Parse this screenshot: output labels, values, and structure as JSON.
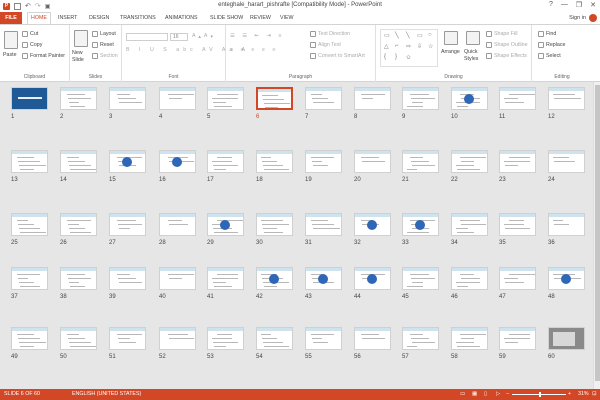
{
  "app": {
    "title": "enteghale_harart_pishrafte [Compatibility Mode] - PowerPoint",
    "sign_in": "Sign in",
    "window_controls": [
      "?",
      "—",
      "❐",
      "✕"
    ]
  },
  "tabs": [
    {
      "label": "FILE",
      "kind": "file"
    },
    {
      "label": "HOME",
      "kind": "active"
    },
    {
      "label": "INSERT"
    },
    {
      "label": "DESIGN"
    },
    {
      "label": "TRANSITIONS"
    },
    {
      "label": "ANIMATIONS"
    },
    {
      "label": "SLIDE SHOW"
    },
    {
      "label": "REVIEW"
    },
    {
      "label": "VIEW"
    }
  ],
  "ribbon": {
    "clipboard": {
      "paste": "Paste",
      "cut": "Cut",
      "copy": "Copy",
      "format_painter": "Format Painter",
      "label": "Clipboard"
    },
    "slides": {
      "new_slide": "New Slide",
      "layout": "Layout",
      "reset": "Reset",
      "section": "Section",
      "label": "Slides"
    },
    "font": {
      "label": "Font",
      "size": "16"
    },
    "paragraph": {
      "text_direction": "Text Direction",
      "align_text": "Align Text",
      "convert_smartart": "Convert to SmartArt",
      "label": "Paragraph"
    },
    "drawing": {
      "arrange": "Arrange",
      "quick_styles": "Quick Styles",
      "shape_fill": "Shape Fill",
      "shape_outline": "Shape Outline",
      "shape_effects": "Shape Effects",
      "label": "Drawing"
    },
    "editing": {
      "find": "Find",
      "replace": "Replace",
      "select": "Select",
      "label": "Editing"
    }
  },
  "slides": {
    "total": 60,
    "selected": 6,
    "special": {
      "1": "title",
      "60": "photo"
    }
  },
  "status": {
    "slide_info": "SLIDE 6 OF 60",
    "language": "ENGLISH (UNITED STATES)",
    "zoom": "31%"
  },
  "colors": {
    "accent": "#d24726",
    "slide_header": "#cfe3ee",
    "blob": "#2e67b7"
  }
}
